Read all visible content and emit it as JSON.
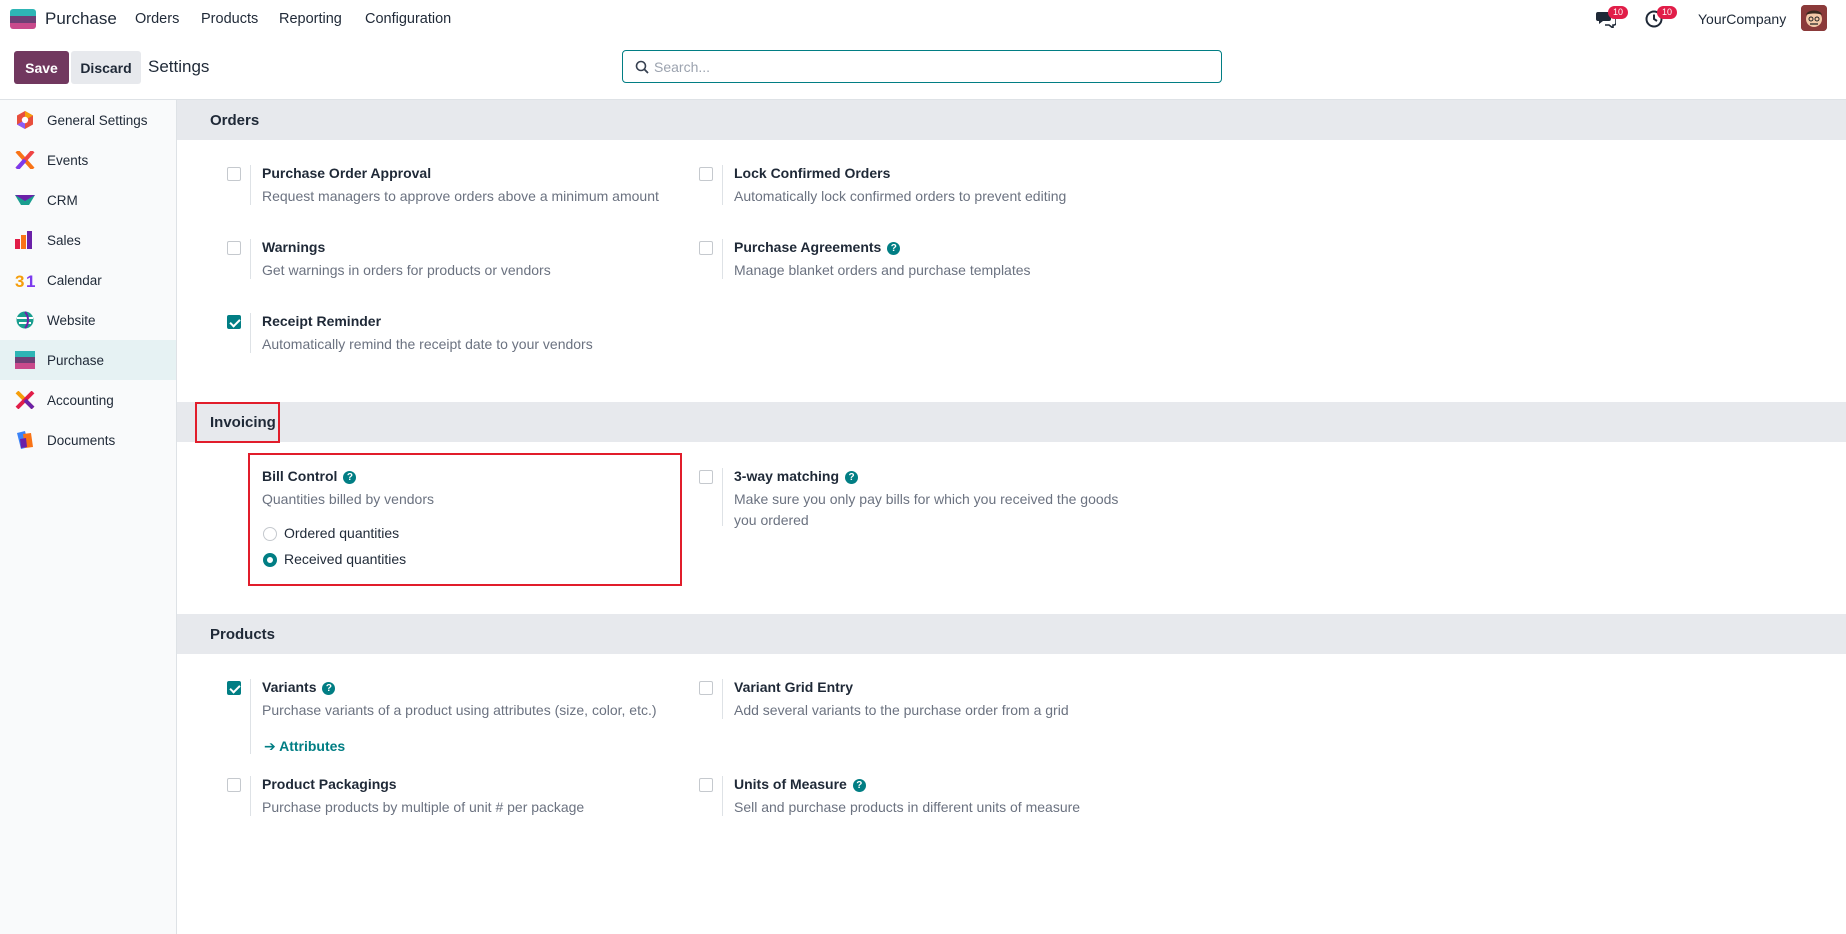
{
  "navbar": {
    "app_name": "Purchase",
    "menu": [
      "Orders",
      "Products",
      "Reporting",
      "Configuration"
    ],
    "messages_count": "10",
    "activities_count": "10",
    "company": "YourCompany"
  },
  "control": {
    "save_label": "Save",
    "discard_label": "Discard",
    "breadcrumb": "Settings",
    "search_placeholder": "Search..."
  },
  "sidebar": {
    "items": [
      {
        "label": "General Settings",
        "icon": "general-settings-icon"
      },
      {
        "label": "Events",
        "icon": "events-icon"
      },
      {
        "label": "CRM",
        "icon": "crm-icon"
      },
      {
        "label": "Sales",
        "icon": "sales-icon"
      },
      {
        "label": "Calendar",
        "icon": "calendar-icon"
      },
      {
        "label": "Website",
        "icon": "website-icon"
      },
      {
        "label": "Purchase",
        "icon": "purchase-icon",
        "active": true
      },
      {
        "label": "Accounting",
        "icon": "accounting-icon"
      },
      {
        "label": "Documents",
        "icon": "documents-icon"
      }
    ]
  },
  "sections": {
    "orders": {
      "title": "Orders",
      "settings": [
        {
          "title": "Purchase Order Approval",
          "desc": "Request managers to approve orders above a minimum amount",
          "checked": false
        },
        {
          "title": "Lock Confirmed Orders",
          "desc": "Automatically lock confirmed orders to prevent editing",
          "checked": false
        },
        {
          "title": "Warnings",
          "desc": "Get warnings in orders for products or vendors",
          "checked": false
        },
        {
          "title": "Purchase Agreements",
          "desc": "Manage blanket orders and purchase templates",
          "checked": false,
          "help": true
        },
        {
          "title": "Receipt Reminder",
          "desc": "Automatically remind the receipt date to your vendors",
          "checked": true
        }
      ]
    },
    "invoicing": {
      "title": "Invoicing",
      "bill_control": {
        "title": "Bill Control",
        "desc": "Quantities billed by vendors",
        "options": [
          "Ordered quantities",
          "Received quantities"
        ],
        "selected": "Received quantities"
      },
      "three_way": {
        "title": "3-way matching",
        "desc": "Make sure you only pay bills for which you received the goods you ordered",
        "checked": false
      }
    },
    "products": {
      "title": "Products",
      "settings": [
        {
          "title": "Variants",
          "desc": "Purchase variants of a product using attributes (size, color, etc.)",
          "checked": true,
          "help": true
        },
        {
          "title": "Variant Grid Entry",
          "desc": "Add several variants to the purchase order from a grid",
          "checked": false
        },
        {
          "title": "Product Packagings",
          "desc": "Purchase products by multiple of unit # per package",
          "checked": false
        },
        {
          "title": "Units of Measure",
          "desc": "Sell and purchase products in different units of measure",
          "checked": false,
          "help": true
        }
      ],
      "attributes_link": "Attributes"
    }
  },
  "colors": {
    "primary": "#71385f",
    "accent": "#017e84",
    "badge": "#e11d48",
    "highlight": "#e11d2b"
  }
}
